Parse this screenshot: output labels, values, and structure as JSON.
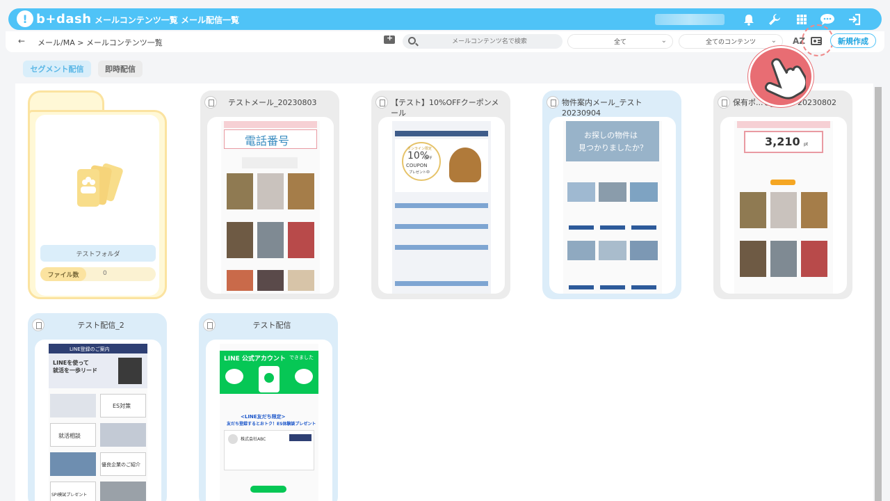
{
  "header": {
    "logo_text": "b+dash",
    "nav": [
      "メールコンテンツ一覧",
      "メール配信一覧"
    ],
    "icons": [
      "bell-icon",
      "wrench-icon",
      "apps-grid-icon",
      "chat-bubble-icon",
      "logout-icon"
    ]
  },
  "subheader": {
    "breadcrumb": "メール/MA > メールコンテンツ一覧",
    "search_placeholder": "メールコンテンツ名で検索",
    "filter_all": "全て",
    "filter_contents": "全てのコンテンツ",
    "sort_label": "AZ",
    "new_button": "新規作成"
  },
  "tabs": {
    "segment": "セグメント配信",
    "instant": "即時配信"
  },
  "folder": {
    "name": "テストフォルダ",
    "count_label": "ファイル数",
    "count_value": "0"
  },
  "mails": [
    {
      "title": "テストメール_20230803"
    },
    {
      "title": "【テスト】10%OFFクーポンメール"
    },
    {
      "title": "物件案内メール_テスト20230904"
    },
    {
      "title": "保有ポ...せ_テスト20230802"
    },
    {
      "title": "テスト配信_2"
    },
    {
      "title": "テスト配信"
    }
  ],
  "thumbs": {
    "phone_title": "電話番号",
    "coupon_line1": "オンライン限定",
    "coupon_big": "10%",
    "coupon_off": "OFF",
    "coupon_word": "COUPON",
    "coupon_present": "プレゼント中",
    "property_headline_1": "お探しの物件は",
    "property_headline_2": "見つかりましたか？",
    "points_value": "3,210",
    "points_unit": "pt",
    "line_guide": "LINE登録のご案内",
    "line_tagline_1": "LINEを使って",
    "line_tagline_2": "就活を一歩リード",
    "line_es": "ES対策",
    "line_consult": "就活相談",
    "line_company": "優良企業のご紹介",
    "line_spi": "SPI模試プレゼント",
    "line_official": "LINE 公式アカウント",
    "line_official_suffix": "できました",
    "line_limited": "<LINE友だち限定>",
    "line_friends": "友だち登録するとおトク！ES体験談プレゼント",
    "line_company_name": "株式会社ABC"
  },
  "colors": {
    "accent": "#4fc3f7",
    "folder_border": "#fbe3a0",
    "pointer": "#e86d73"
  }
}
